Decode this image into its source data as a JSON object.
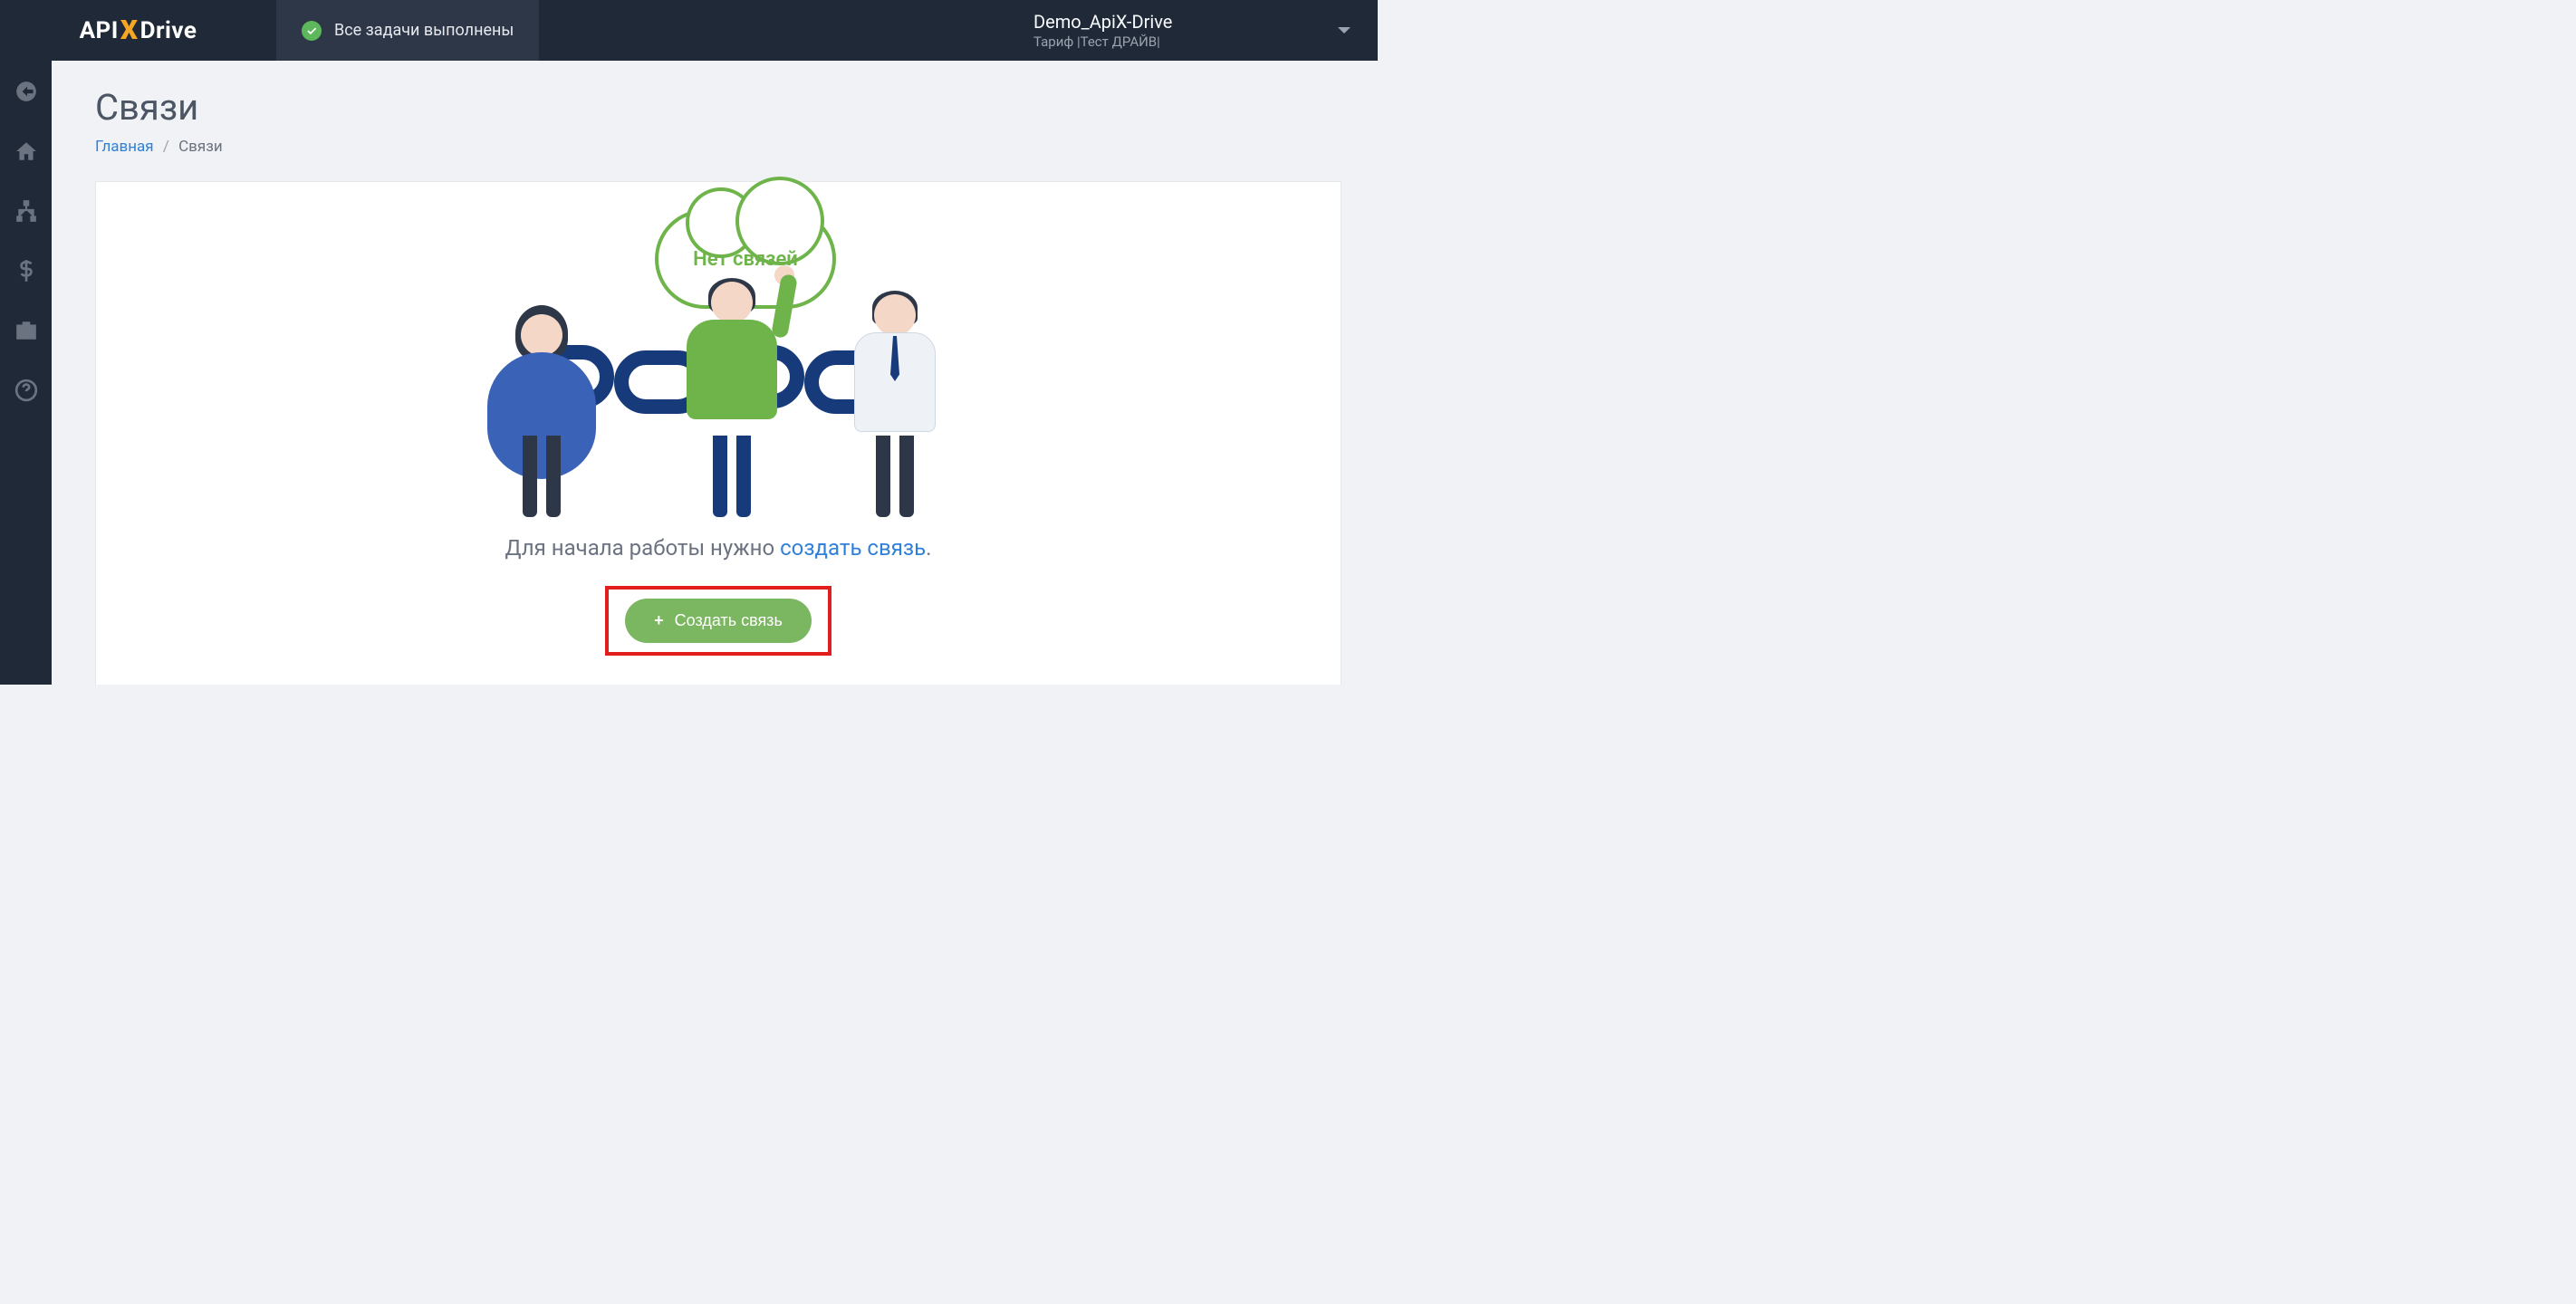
{
  "header": {
    "logo_parts": {
      "api": "API",
      "x": "X",
      "drive": "Drive"
    },
    "status_text": "Все задачи выполнены",
    "account_name": "Demo_ApiX-Drive",
    "account_tariff": "Тариф |Тест ДРАЙВ|"
  },
  "sidebar": {
    "items": [
      {
        "name": "enter-icon"
      },
      {
        "name": "home-icon"
      },
      {
        "name": "sitemap-icon"
      },
      {
        "name": "dollar-icon"
      },
      {
        "name": "briefcase-icon"
      },
      {
        "name": "help-icon"
      }
    ]
  },
  "page": {
    "title": "Связи",
    "breadcrumb_home": "Главная",
    "breadcrumb_current": "Связи"
  },
  "empty_state": {
    "cloud_label": "Нет связей",
    "cta_prefix": "Для начала работы нужно ",
    "cta_link": "создать связь",
    "cta_suffix": ".",
    "button_label": "Создать связь"
  }
}
